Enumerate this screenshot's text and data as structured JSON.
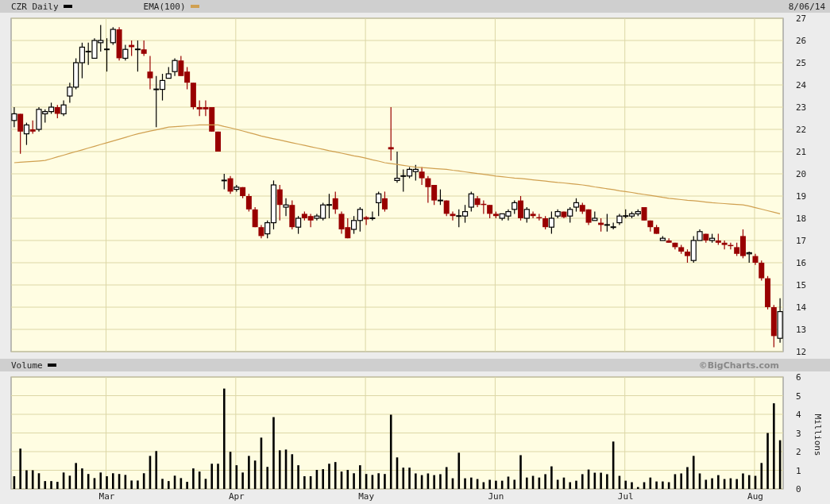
{
  "header": {
    "legend": [
      {
        "label": "CZR Daily",
        "color": "#000000"
      }
    ],
    "date": "8/06/14"
  },
  "price": {
    "chart_data": {
      "type": "candlestick",
      "grid": true,
      "categories": [
        null,
        null,
        null,
        null,
        null,
        null,
        null,
        null,
        null,
        null,
        null,
        null,
        null,
        null,
        null,
        null,
        null,
        null,
        null,
        null,
        null,
        null,
        null,
        null,
        null,
        null,
        null,
        null,
        null,
        null,
        null,
        null,
        null,
        null,
        null,
        null,
        null,
        null,
        null,
        null,
        null,
        null,
        null,
        null,
        null,
        null,
        null,
        null,
        null,
        null,
        null,
        null,
        null,
        null,
        null,
        null,
        null,
        null,
        null,
        null,
        null,
        null,
        null,
        null,
        null,
        null,
        null,
        null,
        null,
        null,
        null,
        null,
        null,
        null,
        null,
        null,
        null,
        null,
        null,
        null,
        null,
        null,
        null,
        null,
        null,
        null,
        null,
        null,
        null,
        null,
        null,
        null,
        null,
        null,
        null,
        null,
        null,
        null,
        null,
        null,
        null,
        null,
        null,
        null,
        null,
        null,
        null,
        null,
        null,
        null,
        null,
        null,
        null,
        null,
        null,
        null,
        null,
        null,
        null,
        null,
        null,
        null,
        null,
        null,
        null
      ],
      "ylim": [
        12,
        27
      ],
      "yticks": [
        12,
        13,
        14,
        15,
        16,
        17,
        18,
        19,
        20,
        21,
        22,
        23,
        24,
        25,
        26,
        27
      ],
      "ohlc": [
        [
          22.4,
          23,
          22.1,
          22.7
        ],
        [
          22.7,
          22.7,
          20.9,
          21.9
        ],
        [
          21.8,
          22.3,
          21.3,
          22.2
        ],
        [
          22.0,
          22.4,
          21.8,
          21.9
        ],
        [
          22.0,
          23.0,
          21.9,
          22.9
        ],
        [
          22.7,
          22.9,
          22.3,
          22.8
        ],
        [
          22.8,
          23.2,
          22.7,
          23.0
        ],
        [
          23.0,
          23.1,
          22.5,
          22.7
        ],
        [
          22.7,
          23.3,
          22.6,
          23.1
        ],
        [
          23.5,
          24.1,
          23.2,
          23.9
        ],
        [
          23.9,
          25.2,
          23.8,
          25.0
        ],
        [
          25.0,
          25.9,
          24.3,
          25.7
        ],
        [
          25.5,
          25.9,
          24.9,
          25.5
        ],
        [
          25.2,
          26.1,
          25.2,
          26.0
        ],
        [
          25.9,
          26.7,
          25.5,
          26.0
        ],
        [
          25.6,
          26.1,
          24.6,
          25.6
        ],
        [
          25.9,
          26.6,
          25.8,
          26.5
        ],
        [
          26.5,
          26.6,
          25.1,
          25.2
        ],
        [
          25.2,
          25.8,
          25.1,
          25.6
        ],
        [
          25.8,
          26.0,
          25.3,
          25.7
        ],
        [
          25.6,
          26.0,
          24.6,
          25.6
        ],
        [
          25.6,
          26.0,
          25.3,
          25.4
        ],
        [
          24.6,
          25.3,
          23.8,
          24.3
        ],
        [
          23.8,
          24.4,
          22.1,
          23.8
        ],
        [
          23.8,
          24.5,
          23.3,
          24.2
        ],
        [
          24.3,
          24.8,
          24.3,
          24.5
        ],
        [
          24.6,
          25.2,
          24.4,
          25.1
        ],
        [
          25.1,
          25.3,
          24.4,
          24.4
        ],
        [
          24.6,
          24.8,
          23.8,
          24.1
        ],
        [
          24.1,
          24.1,
          22.9,
          23.0
        ],
        [
          23.0,
          23.3,
          22.6,
          22.9
        ],
        [
          23.0,
          23.3,
          22.6,
          22.9
        ],
        [
          23.0,
          23.0,
          21.9,
          21.9
        ],
        [
          21.9,
          21.9,
          21.0,
          21.0
        ],
        [
          19.7,
          20.0,
          19.3,
          19.7
        ],
        [
          19.8,
          19.9,
          19.1,
          19.2
        ],
        [
          19.3,
          19.5,
          19.2,
          19.4
        ],
        [
          19.4,
          19.4,
          18.9,
          19.0
        ],
        [
          19.0,
          19.1,
          18.3,
          18.4
        ],
        [
          18.4,
          18.5,
          17.6,
          17.6
        ],
        [
          17.6,
          17.7,
          17.1,
          17.2
        ],
        [
          17.3,
          17.9,
          17.1,
          17.8
        ],
        [
          17.8,
          19.7,
          17.5,
          19.5
        ],
        [
          19.3,
          19.5,
          17.9,
          18.6
        ],
        [
          18.5,
          18.9,
          18.1,
          18.6
        ],
        [
          18.6,
          18.8,
          17.5,
          17.6
        ],
        [
          17.6,
          18.1,
          17.3,
          18.0
        ],
        [
          18.2,
          18.3,
          17.9,
          18.0
        ],
        [
          18.1,
          18.2,
          17.6,
          17.9
        ],
        [
          18.0,
          18.2,
          17.9,
          18.1
        ],
        [
          18.0,
          18.7,
          17.9,
          18.6
        ],
        [
          18.6,
          19.1,
          18.0,
          18.6
        ],
        [
          18.9,
          19.2,
          18.2,
          18.4
        ],
        [
          18.2,
          18.3,
          17.3,
          17.5
        ],
        [
          17.6,
          18.0,
          17.1,
          17.1
        ],
        [
          17.5,
          18.1,
          17.3,
          17.9
        ],
        [
          17.9,
          18.5,
          17.4,
          18.4
        ],
        [
          18.05,
          18.1,
          17.7,
          17.95
        ],
        [
          18.0,
          18.3,
          17.9,
          18.0
        ],
        [
          18.7,
          19.2,
          18.1,
          19.1
        ],
        [
          18.9,
          19.2,
          18.3,
          18.4
        ],
        [
          21.2,
          23.0,
          20.6,
          21.1
        ],
        [
          19.7,
          21.0,
          19.6,
          19.8
        ],
        [
          19.9,
          20.2,
          19.2,
          19.9
        ],
        [
          19.9,
          20.3,
          19.8,
          20.2
        ],
        [
          20.1,
          20.4,
          19.7,
          20.2
        ],
        [
          20.1,
          20.3,
          19.5,
          19.8
        ],
        [
          19.8,
          19.9,
          18.7,
          19.4
        ],
        [
          19.5,
          19.5,
          18.6,
          18.8
        ],
        [
          18.8,
          19.3,
          18.6,
          18.8
        ],
        [
          18.8,
          18.8,
          18.1,
          18.2
        ],
        [
          18.2,
          18.3,
          17.9,
          18.1
        ],
        [
          18.1,
          18.4,
          17.6,
          18.1
        ],
        [
          18.1,
          18.6,
          17.8,
          18.3
        ],
        [
          18.5,
          19.2,
          18.3,
          19.1
        ],
        [
          18.9,
          19.0,
          18.5,
          18.6
        ],
        [
          18.65,
          18.8,
          18.2,
          18.6
        ],
        [
          18.6,
          18.6,
          18.0,
          18.2
        ],
        [
          18.2,
          18.3,
          18.0,
          18.1
        ],
        [
          18.0,
          18.2,
          17.9,
          18.2
        ],
        [
          18.1,
          18.4,
          17.9,
          18.3
        ],
        [
          18.4,
          18.8,
          18.2,
          18.7
        ],
        [
          18.8,
          19.0,
          17.9,
          18.0
        ],
        [
          18.0,
          18.5,
          17.8,
          18.4
        ],
        [
          18.2,
          18.3,
          18.0,
          18.1
        ],
        [
          18.05,
          18.2,
          17.9,
          18.0
        ],
        [
          18.0,
          18.1,
          17.5,
          17.6
        ],
        [
          17.6,
          18.3,
          17.3,
          18.0
        ],
        [
          18.1,
          18.4,
          18.0,
          18.3
        ],
        [
          18.3,
          18.3,
          18.0,
          18.05
        ],
        [
          18.1,
          18.5,
          17.8,
          18.4
        ],
        [
          18.5,
          18.9,
          18.3,
          18.7
        ],
        [
          18.6,
          18.7,
          18.2,
          18.3
        ],
        [
          18.4,
          18.4,
          17.7,
          17.8
        ],
        [
          17.9,
          18.3,
          17.9,
          18.0
        ],
        [
          17.8,
          18.0,
          17.4,
          17.7
        ],
        [
          17.7,
          18.2,
          17.4,
          17.7
        ],
        [
          17.6,
          17.8,
          17.5,
          17.6
        ],
        [
          17.8,
          18.2,
          17.7,
          18.1
        ],
        [
          18.1,
          18.4,
          18.0,
          18.1
        ],
        [
          18.1,
          18.3,
          18.0,
          18.2
        ],
        [
          18.2,
          18.4,
          18.1,
          18.3
        ],
        [
          18.5,
          18.5,
          17.9,
          17.9
        ],
        [
          17.9,
          17.9,
          17.4,
          17.6
        ],
        [
          17.6,
          17.7,
          17.3,
          17.3
        ],
        [
          17.0,
          17.2,
          17.0,
          17.1
        ],
        [
          17.0,
          17.1,
          16.9,
          16.9
        ],
        [
          16.9,
          16.9,
          16.6,
          16.7
        ],
        [
          16.7,
          16.8,
          16.4,
          16.5
        ],
        [
          16.5,
          16.6,
          16.0,
          16.3
        ],
        [
          16.1,
          17.2,
          16.0,
          17.0
        ],
        [
          17.0,
          17.5,
          17.0,
          17.4
        ],
        [
          17.3,
          17.3,
          16.9,
          17.0
        ],
        [
          17.0,
          17.3,
          16.9,
          17.1
        ],
        [
          17.0,
          17.3,
          16.8,
          16.9
        ],
        [
          16.9,
          17.0,
          16.6,
          16.8
        ],
        [
          16.8,
          16.9,
          16.6,
          16.75
        ],
        [
          16.7,
          16.9,
          16.3,
          16.4
        ],
        [
          17.2,
          17.5,
          16.2,
          16.3
        ],
        [
          16.4,
          16.5,
          16.0,
          16.45
        ],
        [
          16.3,
          16.4,
          15.9,
          16.0
        ],
        [
          16.0,
          16.1,
          15.2,
          15.3
        ],
        [
          15.3,
          15.4,
          13.9,
          14.0
        ],
        [
          14.0,
          14.1,
          12.2,
          12.7
        ],
        [
          12.6,
          14.4,
          12.4,
          13.8
        ]
      ]
    }
  },
  "overlay": {
    "chart_data": {
      "type": "line",
      "ylim": [
        12,
        27
      ],
      "categories": [
        null,
        null,
        null,
        null,
        null,
        null,
        null,
        null,
        null,
        null,
        null,
        null,
        null,
        null,
        null,
        null,
        null,
        null,
        null,
        null,
        null,
        null,
        null,
        null,
        null,
        null,
        null,
        null,
        null,
        null,
        null,
        null,
        null,
        null,
        null,
        null,
        null,
        null,
        null,
        null,
        null,
        null,
        null,
        null,
        null,
        null,
        null,
        null,
        null,
        null,
        null,
        null,
        null,
        null,
        null,
        null,
        null,
        null,
        null,
        null,
        null,
        null,
        null,
        null,
        null,
        null,
        null,
        null,
        null,
        null,
        null,
        null,
        null,
        null,
        null,
        null,
        null,
        null,
        null,
        null,
        null,
        null,
        null,
        null,
        null,
        null,
        null,
        null,
        null,
        null,
        null,
        null,
        null,
        null,
        null,
        null,
        null,
        null,
        null,
        null,
        null,
        null,
        null,
        null,
        null,
        null,
        null,
        null,
        null,
        null,
        null,
        null,
        null,
        null,
        null,
        null,
        null,
        null,
        null,
        null,
        null,
        null,
        null,
        null,
        null
      ],
      "series": [
        {
          "name": "EMA(100)",
          "color": "#d0a050",
          "values": [
            20.5,
            20.52,
            20.54,
            20.56,
            20.58,
            20.6,
            20.68,
            20.76,
            20.84,
            20.92,
            21.0,
            21.08,
            21.16,
            21.24,
            21.32,
            21.4,
            21.48,
            21.56,
            21.64,
            21.72,
            21.8,
            21.86,
            21.92,
            21.98,
            22.04,
            22.1,
            22.12,
            22.14,
            22.16,
            22.18,
            22.2,
            22.2,
            22.2,
            22.2,
            22.13,
            22.07,
            22.0,
            21.93,
            21.85,
            21.78,
            21.7,
            21.64,
            21.58,
            21.52,
            21.46,
            21.4,
            21.34,
            21.28,
            21.22,
            21.16,
            21.1,
            21.04,
            20.99,
            20.93,
            20.87,
            20.81,
            20.76,
            20.7,
            20.63,
            20.57,
            20.5,
            20.46,
            20.42,
            20.38,
            20.34,
            20.3,
            20.28,
            20.26,
            20.24,
            20.22,
            20.2,
            20.16,
            20.13,
            20.09,
            20.05,
            20.01,
            19.98,
            19.94,
            19.9,
            19.87,
            19.84,
            19.81,
            19.79,
            19.76,
            19.73,
            19.7,
            19.67,
            19.64,
            19.61,
            19.59,
            19.56,
            19.53,
            19.5,
            19.46,
            19.41,
            19.37,
            19.33,
            19.29,
            19.24,
            19.2,
            19.16,
            19.11,
            19.07,
            19.03,
            18.99,
            18.94,
            18.9,
            18.87,
            18.84,
            18.81,
            18.79,
            18.76,
            18.73,
            18.7,
            18.68,
            18.66,
            18.64,
            18.62,
            18.6,
            18.55,
            18.48,
            18.41,
            18.34,
            18.27,
            18.2
          ]
        }
      ]
    }
  },
  "volume": {
    "credit": "©BigCharts.com",
    "chart_data": {
      "type": "bar",
      "grid": true,
      "ylabel": "Millions",
      "categories": [
        null,
        null,
        null,
        null,
        null,
        null,
        null,
        null,
        null,
        null,
        null,
        null,
        null,
        null,
        null,
        "Mar",
        null,
        null,
        null,
        null,
        null,
        null,
        null,
        null,
        null,
        null,
        null,
        null,
        null,
        null,
        null,
        null,
        null,
        null,
        null,
        null,
        "Apr",
        null,
        null,
        null,
        null,
        null,
        null,
        null,
        null,
        null,
        null,
        null,
        null,
        null,
        null,
        null,
        null,
        null,
        null,
        null,
        null,
        "May",
        null,
        null,
        null,
        null,
        null,
        null,
        null,
        null,
        null,
        null,
        null,
        null,
        null,
        null,
        null,
        null,
        null,
        null,
        null,
        null,
        "Jun",
        null,
        null,
        null,
        null,
        null,
        null,
        null,
        null,
        null,
        null,
        null,
        null,
        null,
        null,
        null,
        null,
        null,
        null,
        null,
        null,
        "Jul",
        null,
        null,
        null,
        null,
        null,
        null,
        null,
        null,
        null,
        null,
        null,
        null,
        null,
        null,
        null,
        null,
        null,
        null,
        null,
        null,
        "Aug",
        null,
        null,
        null,
        null
      ],
      "ylim": [
        0,
        6
      ],
      "yticks": [
        0,
        1,
        2,
        3,
        4,
        5,
        6
      ],
      "series": [
        {
          "name": "Volume",
          "color": "#000000",
          "values": [
            0.68,
            2.16,
            1.0,
            1.0,
            0.84,
            0.42,
            0.42,
            0.38,
            0.88,
            0.71,
            1.39,
            1.1,
            0.8,
            0.58,
            0.88,
            0.68,
            0.84,
            0.8,
            0.75,
            0.45,
            0.45,
            0.84,
            1.77,
            2.03,
            0.54,
            0.42,
            0.71,
            0.58,
            0.38,
            1.1,
            0.93,
            0.54,
            1.35,
            1.35,
            5.38,
            1.99,
            1.27,
            0.88,
            1.77,
            1.52,
            2.75,
            1.18,
            3.85,
            2.07,
            2.11,
            1.86,
            1.27,
            0.68,
            0.68,
            1.02,
            1.06,
            1.35,
            1.44,
            0.93,
            1.02,
            0.84,
            1.27,
            0.8,
            0.75,
            0.84,
            0.8,
            3.98,
            1.69,
            1.14,
            1.14,
            0.83,
            0.74,
            0.83,
            0.74,
            0.79,
            1.17,
            0.57,
            1.94,
            0.57,
            0.61,
            0.53,
            0.36,
            0.49,
            0.44,
            0.44,
            0.66,
            0.49,
            1.81,
            0.61,
            0.7,
            0.61,
            0.79,
            1.21,
            0.49,
            0.61,
            0.36,
            0.44,
            0.79,
            1.04,
            0.87,
            0.87,
            0.79,
            2.54,
            0.7,
            0.44,
            0.36,
            0.1,
            0.36,
            0.61,
            0.4,
            0.4,
            0.36,
            0.79,
            0.83,
            1.17,
            1.77,
            0.83,
            0.49,
            0.57,
            0.74,
            0.53,
            0.57,
            0.53,
            0.83,
            0.74,
            0.7,
            1.39,
            3.0,
            4.59,
            2.61
          ]
        }
      ]
    }
  }
}
